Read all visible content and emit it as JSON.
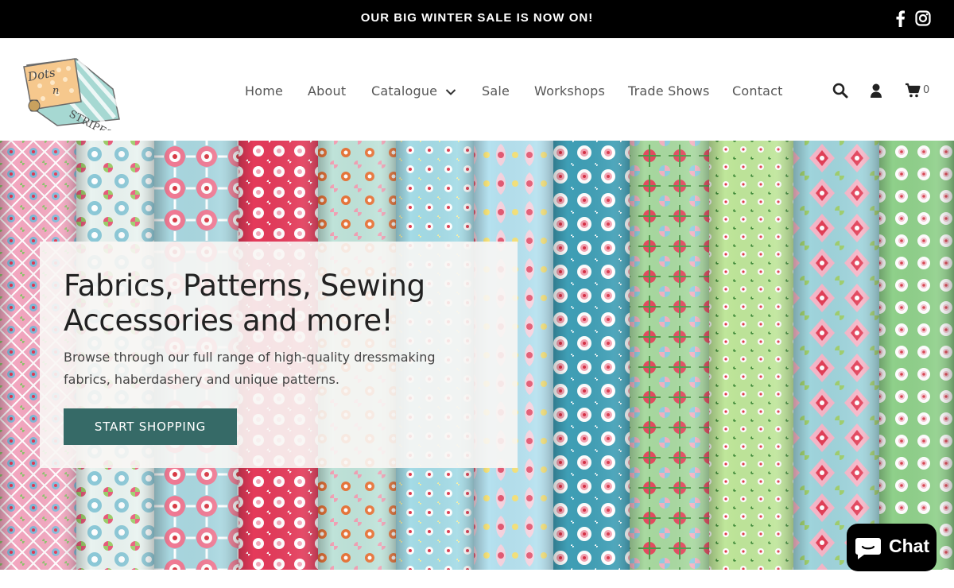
{
  "announcement": {
    "text": "OUR BIG WINTER SALE IS NOW ON!"
  },
  "social": {
    "icons": [
      "facebook-icon",
      "instagram-icon"
    ]
  },
  "brand": {
    "logo_lines": [
      "Dots",
      "n",
      "STRIPES"
    ]
  },
  "nav": {
    "items": [
      "Home",
      "About",
      "Catalogue",
      "Sale",
      "Workshops",
      "Trade Shows",
      "Contact"
    ]
  },
  "header_icons": {
    "icons": [
      "search-icon",
      "account-icon",
      "cart-icon"
    ],
    "cart_count": "0"
  },
  "hero": {
    "title": "Fabrics, Patterns, Sewing Accessories and more!",
    "subtitle": "Browse through our full range of high-quality dressmaking fabrics, haberdashery and unique patterns.",
    "button_label": "START SHOPPING"
  },
  "chat": {
    "label": "Chat"
  },
  "colors": {
    "accent": "#366a67",
    "topbar": "#000000"
  }
}
